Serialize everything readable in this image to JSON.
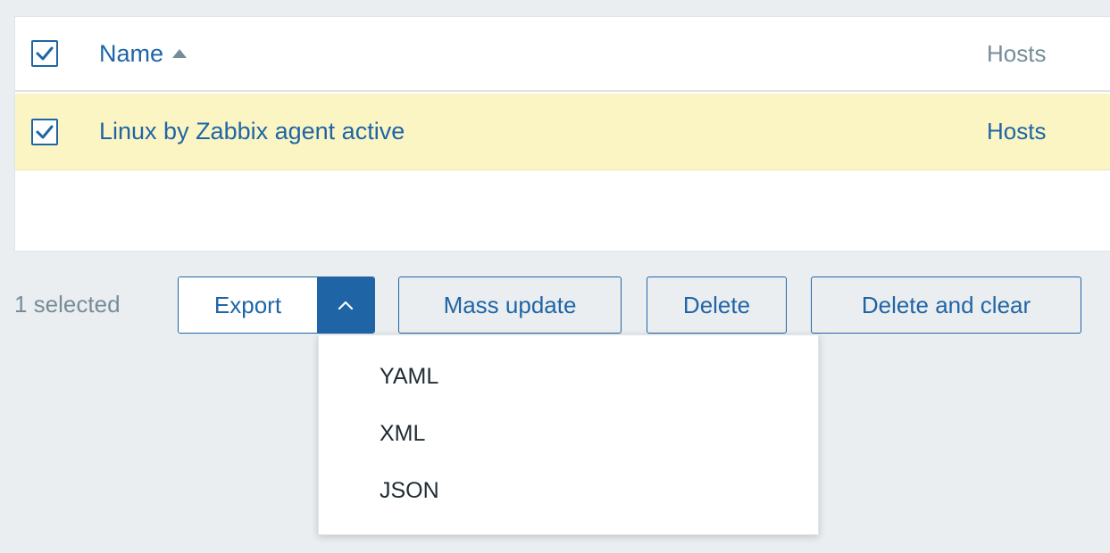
{
  "table": {
    "header": {
      "name_label": "Name",
      "hosts_label": "Hosts",
      "sort_icon": "sort-ascending-icon"
    },
    "rows": [
      {
        "name": "Linux by Zabbix agent active",
        "hosts": "Hosts",
        "selected": true
      }
    ]
  },
  "action_bar": {
    "selected_text": "1 selected",
    "export_label": "Export",
    "mass_update_label": "Mass update",
    "delete_label": "Delete",
    "delete_clear_label": "Delete and clear"
  },
  "export_menu": {
    "items": [
      "YAML",
      "XML",
      "JSON"
    ]
  },
  "colors": {
    "accent": "#1f65a6",
    "row_highlight": "#fbf5c4",
    "background": "#ebeef0",
    "muted_text": "#768d99"
  }
}
